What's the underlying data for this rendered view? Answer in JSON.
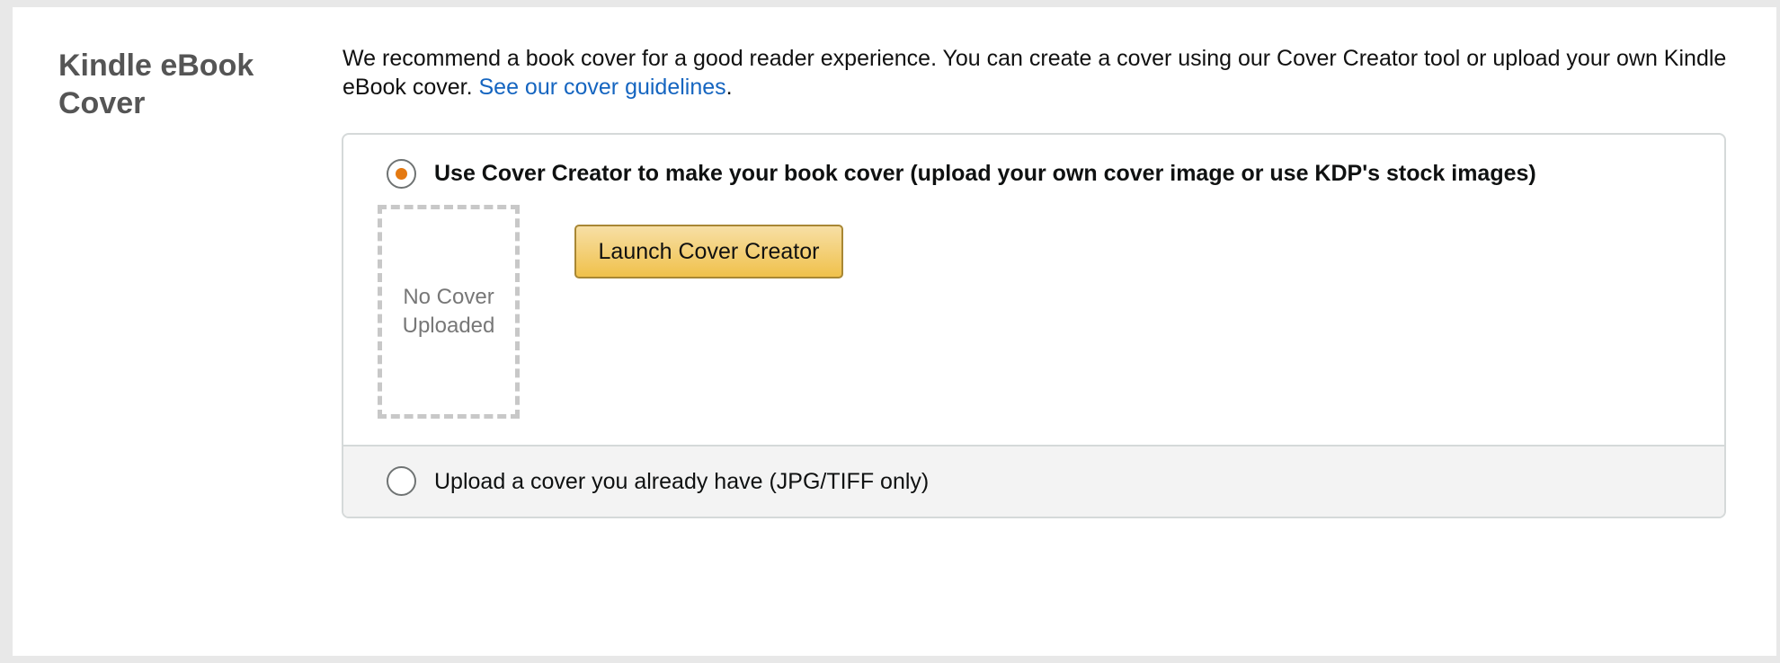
{
  "section": {
    "title": "Kindle eBook Cover"
  },
  "intro": {
    "text": "We recommend a book cover for a good reader experience. You can create a cover using our Cover Creator tool or upload your own Kindle eBook cover. ",
    "link_text": "See our cover guidelines",
    "suffix": "."
  },
  "options": {
    "cover_creator": {
      "label": "Use Cover Creator to make your book cover (upload your own cover image or use KDP's stock images)",
      "selected": true,
      "placeholder_text": "No Cover\nUploaded",
      "button_label": "Launch Cover Creator"
    },
    "upload": {
      "label": "Upload a cover you already have (JPG/TIFF only)",
      "selected": false
    }
  },
  "colors": {
    "link": "#1565c0",
    "radio_selected": "#e47911",
    "button_top": "#f7dfa5",
    "button_bottom": "#f0c14b"
  }
}
